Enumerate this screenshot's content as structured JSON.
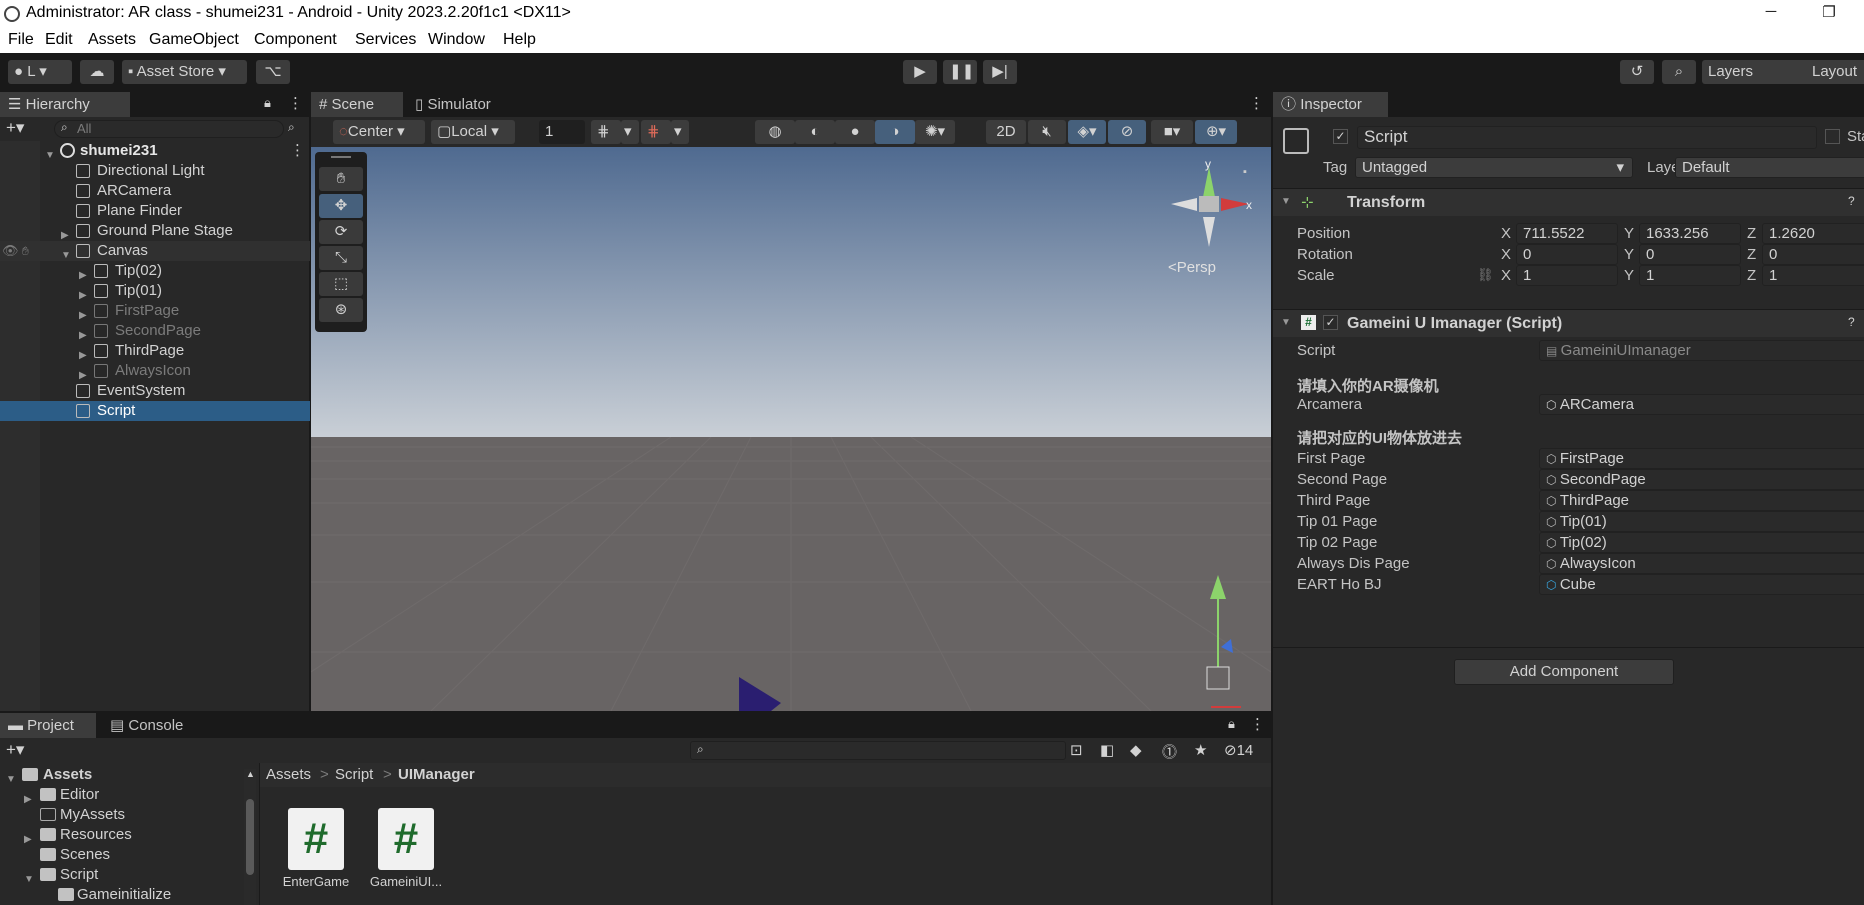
{
  "window": {
    "title": "Administrator: AR class - shumei231 - Android - Unity 2023.2.20f1c1 <DX11>",
    "minimize_icon": "minimize-icon",
    "maximize_icon": "restore-icon"
  },
  "menu": [
    "File",
    "Edit",
    "Assets",
    "GameObject",
    "Component",
    "Services",
    "Window",
    "Help"
  ],
  "toolbar": {
    "account": "L",
    "asset_store": "Asset Store",
    "layers": "Layers",
    "layout": "Layout"
  },
  "hierarchy": {
    "tab": "Hierarchy",
    "search_placeholder": "All",
    "scene": "shumei231",
    "items": [
      {
        "label": "Directional Light"
      },
      {
        "label": "ARCamera"
      },
      {
        "label": "Plane Finder"
      },
      {
        "label": "Ground Plane Stage"
      },
      {
        "label": "Canvas"
      },
      {
        "label": "Tip(02)"
      },
      {
        "label": "Tip(01)"
      },
      {
        "label": "FirstPage"
      },
      {
        "label": "SecondPage"
      },
      {
        "label": "ThirdPage"
      },
      {
        "label": "AlwaysIcon"
      },
      {
        "label": "EventSystem"
      },
      {
        "label": "Script"
      }
    ]
  },
  "scene": {
    "tabs": [
      "Scene",
      "Simulator"
    ],
    "pivot": "Center",
    "space": "Local",
    "grid_value": "1",
    "mode_2d": "2D",
    "persp": "<Persp",
    "gizmo_y": "y",
    "gizmo_x": "x",
    "colors": {
      "sky_top": "#4f6a90",
      "sky_bottom": "#c9cfd6",
      "ground": "#686464"
    }
  },
  "inspector": {
    "tab": "Inspector",
    "object_name": "Script",
    "tag_label": "Tag",
    "tag": "Untagged",
    "layer_label": "Layer",
    "layer": "Default",
    "static_label": "Sta",
    "transform": {
      "title": "Transform",
      "rows": [
        {
          "label": "Position",
          "x": "711.5522",
          "y": "1633.256",
          "z": "1.2620"
        },
        {
          "label": "Rotation",
          "x": "0",
          "y": "0",
          "z": "0"
        },
        {
          "label": "Scale",
          "x": "1",
          "y": "1",
          "z": "1"
        }
      ],
      "axis": [
        "X",
        "Y",
        "Z"
      ]
    },
    "component": {
      "title": "Gameini U Imanager (Script)",
      "script_label": "Script",
      "script_value": "GameiniUImanager",
      "header1": "请填入你的AR摄像机",
      "arcamera_label": "Arcamera",
      "arcamera_value": "ARCamera",
      "header2": "请把对应的UI物体放进去",
      "refs": [
        {
          "label": "First Page",
          "value": "FirstPage"
        },
        {
          "label": "Second Page",
          "value": "SecondPage"
        },
        {
          "label": "Third Page",
          "value": "ThirdPage"
        },
        {
          "label": "Tip 01 Page",
          "value": "Tip(01)"
        },
        {
          "label": "Tip 02 Page",
          "value": "Tip(02)"
        },
        {
          "label": "Always Dis Page",
          "value": "AlwaysIcon"
        },
        {
          "label": "EART Ho BJ",
          "value": "Cube"
        }
      ]
    },
    "add_component": "Add Component"
  },
  "project": {
    "tabs": [
      "Project",
      "Console"
    ],
    "hidden_count": "14",
    "breadcrumb": [
      "Assets",
      "Script",
      "UIManager"
    ],
    "tree": [
      {
        "label": "Assets"
      },
      {
        "label": "Editor"
      },
      {
        "label": "MyAssets"
      },
      {
        "label": "Resources"
      },
      {
        "label": "Scenes"
      },
      {
        "label": "Script"
      },
      {
        "label": "Gameinitialize"
      }
    ],
    "files": [
      {
        "label": "EnterGame"
      },
      {
        "label": "GameiniUI..."
      }
    ],
    "file_glyph": "#"
  }
}
